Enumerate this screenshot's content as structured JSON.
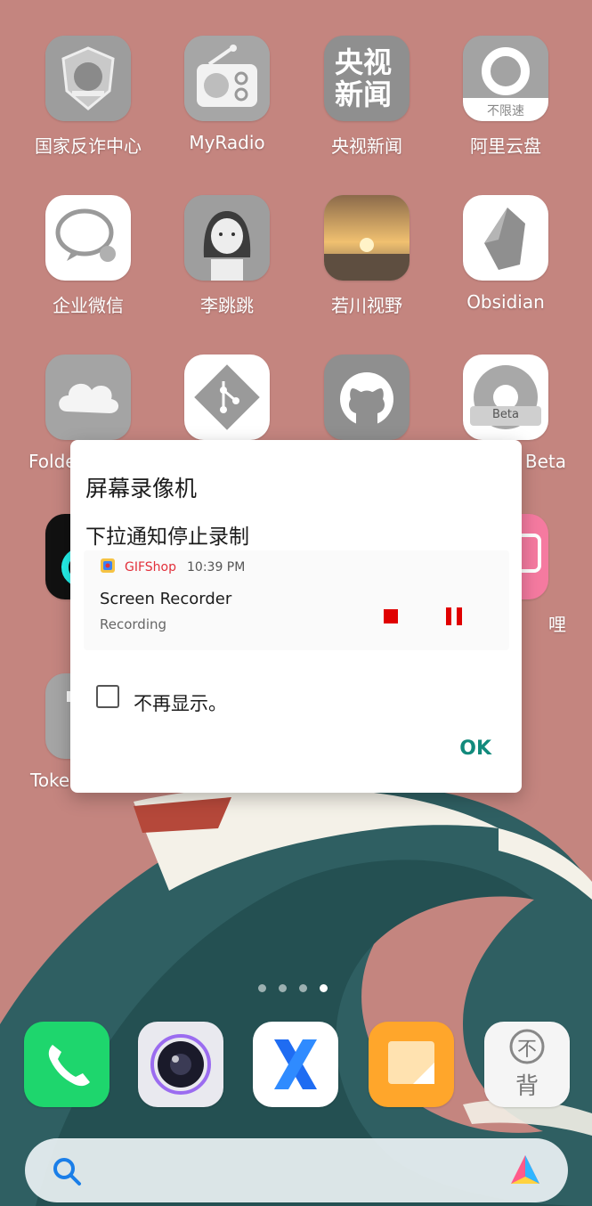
{
  "home": {
    "row1": [
      "国家反诈中心",
      "MyRadio",
      "央视新闻",
      "阿里云盘"
    ],
    "row2": [
      "企业微信",
      "李跳跳",
      "若川视野",
      "Obsidian"
    ],
    "row3": [
      "Folde",
      "Beta"
    ],
    "row4": [
      "哩"
    ],
    "row5": [
      "Toke"
    ],
    "icon_texts": {
      "cctv_line1": "央视",
      "cctv_line2": "新闻",
      "aliyun_badge": "不限速",
      "beta_badge": "Beta",
      "bei_top": "不",
      "bei_bottom": "背"
    }
  },
  "dialog": {
    "title": "屏幕录像机",
    "message": "下拉通知停止录制",
    "notification": {
      "app": "GIFShop",
      "time": "10:39 PM",
      "title": "Screen Recorder",
      "subtitle": "Recording"
    },
    "checkbox_label": "不再显示。",
    "ok_label": "OK"
  },
  "colors": {
    "wallpaper": "#c4857f",
    "accent": "#128a7c",
    "record_red": "#e00000"
  },
  "dock": [
    "phone-icon",
    "camera-icon",
    "x-browser-icon",
    "notes-icon",
    "bubei-icon"
  ],
  "search": {
    "left_icon": "search-icon",
    "right_icon": "assistant-icon"
  }
}
